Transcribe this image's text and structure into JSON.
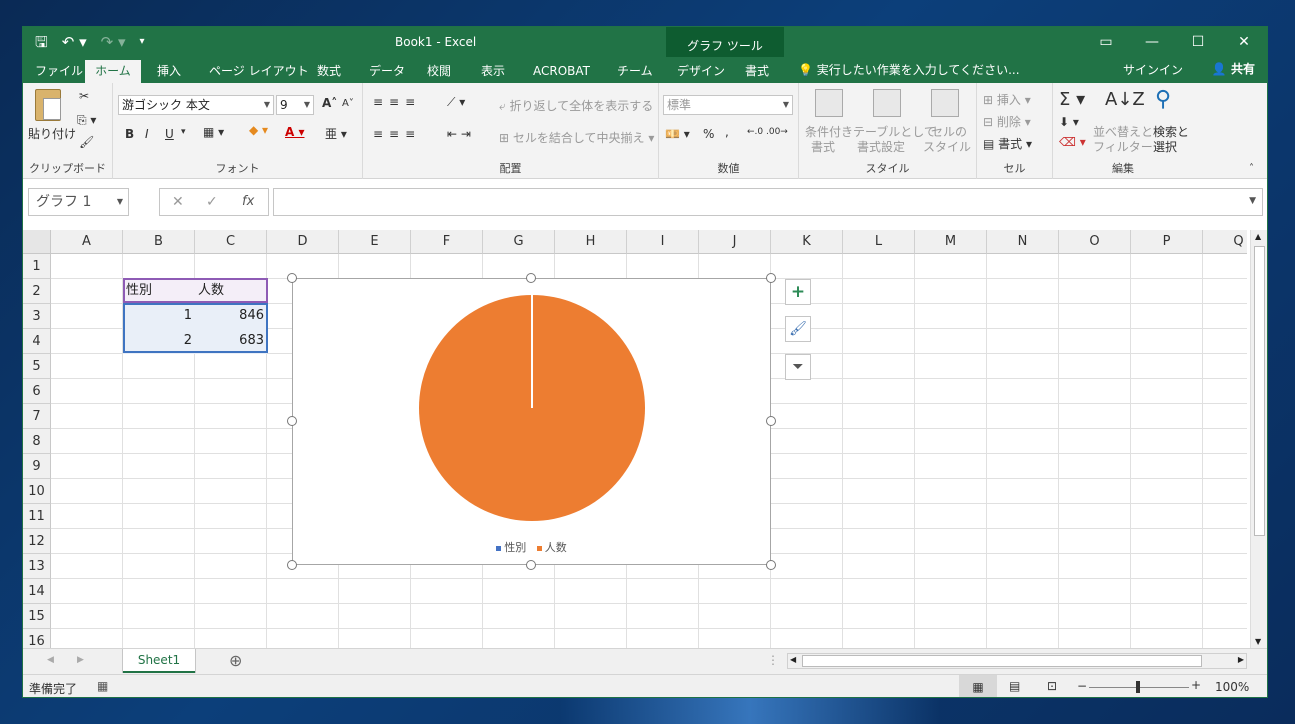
{
  "titlebar": {
    "title": "Book1 - Excel",
    "context_group": "グラフ ツール",
    "save_icon": "save-icon",
    "undo_icon": "undo-icon",
    "redo_icon": "redo-icon",
    "customize_icon": "customize-qat-icon"
  },
  "tabs": [
    {
      "label": "ファイル"
    },
    {
      "label": "ホーム",
      "active": true
    },
    {
      "label": "挿入"
    },
    {
      "label": "ページ レイアウト"
    },
    {
      "label": "数式"
    },
    {
      "label": "データ"
    },
    {
      "label": "校閲"
    },
    {
      "label": "表示"
    },
    {
      "label": "ACROBAT"
    },
    {
      "label": "チーム"
    },
    {
      "label": "デザイン"
    },
    {
      "label": "書式"
    }
  ],
  "tellme": "実行したい作業を入力してください...",
  "signin": "サインイン",
  "share": "共有",
  "ribbon": {
    "clipboard": {
      "paste": "貼り付け",
      "label": "クリップボード"
    },
    "font": {
      "name": "游ゴシック 本文",
      "size": "9",
      "bold": "B",
      "italic": "I",
      "underline": "U",
      "grow": "A",
      "shrink": "A",
      "label": "フォント"
    },
    "align": {
      "wrap": "折り返して全体を表示する",
      "merge": "セルを結合して中央揃え",
      "label": "配置"
    },
    "number": {
      "format": "標準",
      "percent": "%",
      "comma": ",",
      "label": "数値"
    },
    "styles": {
      "conditional": "条件付き",
      "conditional2": "書式",
      "table": "テーブルとして",
      "table2": "書式設定",
      "cell": "セルの",
      "cell2": "スタイル",
      "label": "スタイル"
    },
    "cells": {
      "insert": "挿入",
      "delete": "削除",
      "format": "書式",
      "label": "セル"
    },
    "editing": {
      "sort": "並べ替えと",
      "sort2": "フィルター",
      "find": "検索と",
      "find2": "選択",
      "label": "編集"
    }
  },
  "namebox": "グラフ 1",
  "columns": [
    "A",
    "B",
    "C",
    "D",
    "E",
    "F",
    "G",
    "H",
    "I",
    "J",
    "K",
    "L",
    "M",
    "N",
    "O",
    "P",
    "Q"
  ],
  "rows": [
    "1",
    "2",
    "3",
    "4",
    "5",
    "6",
    "7",
    "8",
    "9",
    "10",
    "11",
    "12",
    "13",
    "14",
    "15",
    "16"
  ],
  "cells": {
    "B2": "性別",
    "C2": "人数",
    "B3": "1",
    "C3": "846",
    "B4": "2",
    "C4": "683"
  },
  "chart_data": {
    "type": "pie",
    "categories": [
      "1",
      "2"
    ],
    "series": [
      {
        "name": "人数",
        "values": [
          846,
          683
        ]
      }
    ],
    "legend": [
      "性別",
      "人数"
    ],
    "legend_position": "bottom",
    "colors": {
      "性別": "#4472c4",
      "人数": "#ed7d31"
    },
    "notes": "Pie shows a single orange full slice with a thin white divider line from top to center"
  },
  "sheet": {
    "tab": "Sheet1"
  },
  "status": {
    "ready": "準備完了",
    "zoom": "100%"
  },
  "colors": {
    "accent": "#217346",
    "pie": "#ed7d31"
  }
}
